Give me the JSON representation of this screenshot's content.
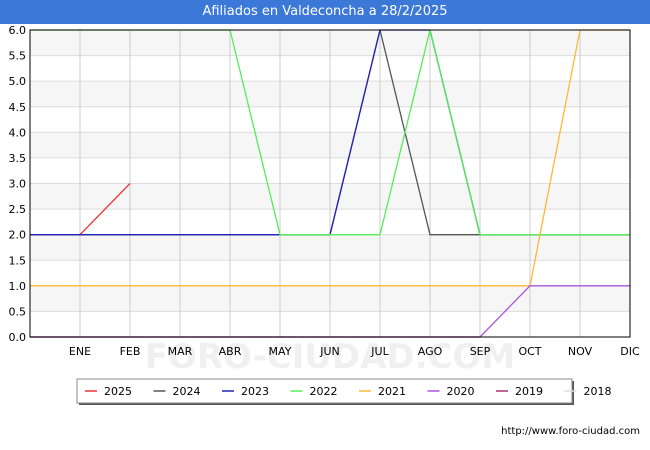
{
  "chart_data": {
    "type": "line",
    "title": "Afiliados en Valdeconcha a 28/2/2025",
    "categories": [
      "",
      "ENE",
      "FEB",
      "MAR",
      "ABR",
      "MAY",
      "JUN",
      "JUL",
      "AGO",
      "SEP",
      "OCT",
      "NOV",
      "DIC"
    ],
    "ylim": [
      0,
      6
    ],
    "yticks": [
      "0.0",
      "0.5",
      "1.0",
      "1.5",
      "2.0",
      "2.5",
      "3.0",
      "3.5",
      "4.0",
      "4.5",
      "5.0",
      "5.5",
      "6.0"
    ],
    "grid": true,
    "legend_position": "bottom",
    "watermark": "FORO-CIUDAD.COM",
    "series": [
      {
        "name": "2025",
        "color": "#ee3333",
        "values": [
          2,
          2,
          3
        ]
      },
      {
        "name": "2024",
        "color": "#555555",
        "values": [
          2,
          2,
          2,
          2,
          2,
          2,
          2,
          6,
          2,
          2,
          2,
          2,
          2
        ]
      },
      {
        "name": "2023",
        "color": "#2222bb",
        "values": [
          2,
          2,
          2,
          2,
          2,
          2,
          2,
          6,
          6,
          2,
          2,
          2,
          2
        ]
      },
      {
        "name": "2022",
        "color": "#55ee55",
        "values": [
          6,
          6,
          6,
          6,
          6,
          2,
          2,
          2,
          6,
          2,
          2,
          2,
          2
        ]
      },
      {
        "name": "2021",
        "color": "#ffb833",
        "values": [
          1,
          1,
          1,
          1,
          1,
          1,
          1,
          1,
          1,
          1,
          1,
          6,
          6
        ]
      },
      {
        "name": "2020",
        "color": "#aa55dd",
        "values": [
          0,
          0,
          0,
          0,
          0,
          0,
          0,
          0,
          0,
          0,
          1,
          1,
          1
        ]
      },
      {
        "name": "2019",
        "color": "#aa3377",
        "values": [
          0,
          0,
          0,
          0,
          0,
          0,
          0,
          0,
          0,
          0
        ]
      },
      {
        "name": "2018",
        "color": "#dddddd",
        "values": []
      }
    ]
  },
  "footer": {
    "url": "http://www.foro-ciudad.com"
  }
}
